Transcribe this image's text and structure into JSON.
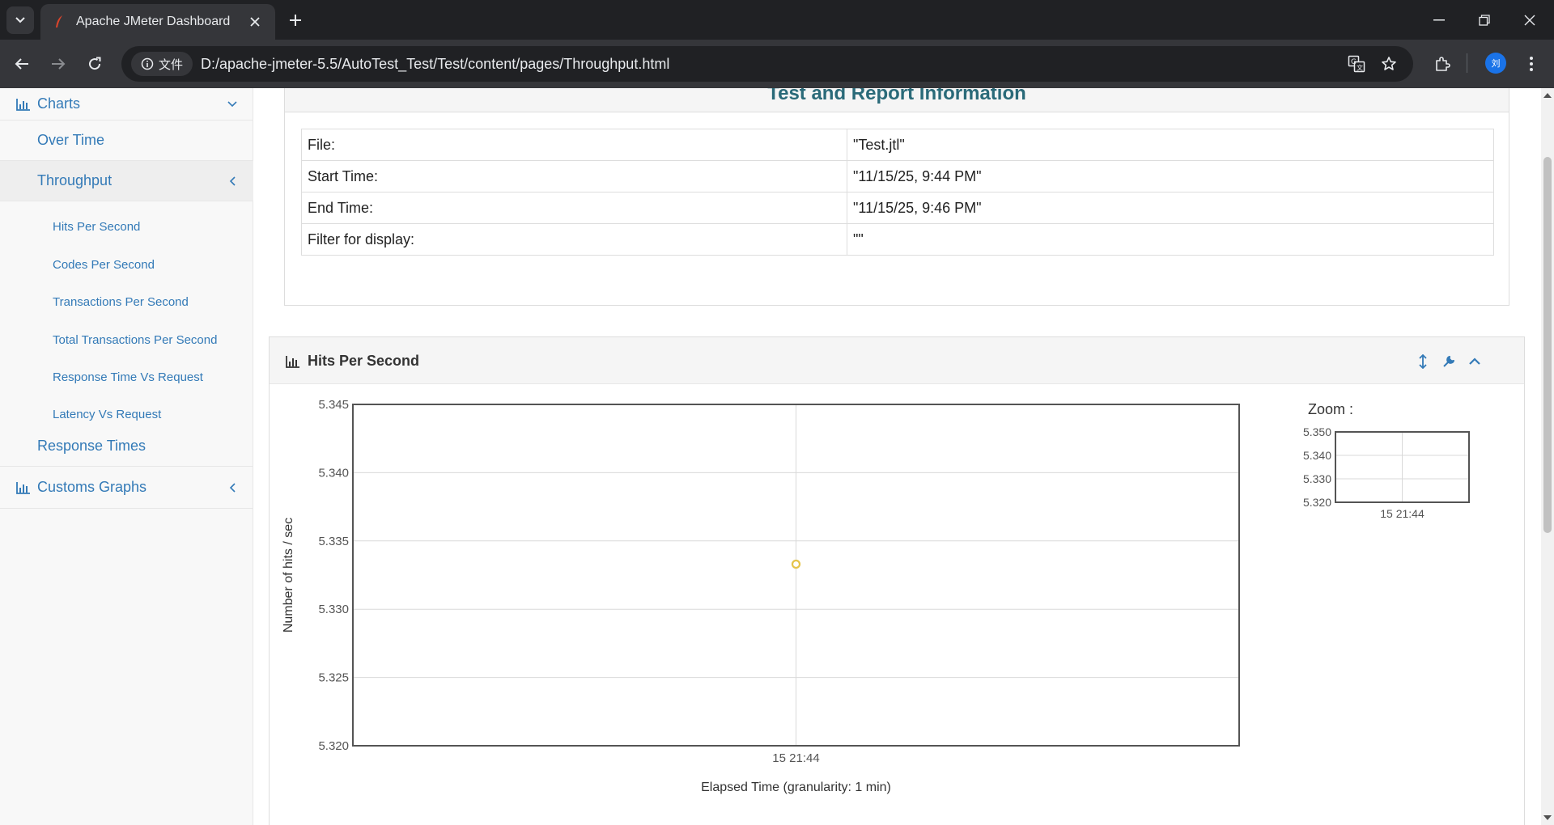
{
  "browser": {
    "tab_title": "Apache JMeter Dashboard",
    "site_chip": "文件",
    "url": "D:/apache-jmeter-5.5/AutoTest_Test/Test/content/pages/Throughput.html",
    "profile_initial": "刘"
  },
  "sidebar": {
    "charts_label": "Charts",
    "over_time": "Over Time",
    "throughput": "Throughput",
    "sub_items": [
      "Hits Per Second",
      "Codes Per Second",
      "Transactions Per Second",
      "Total Transactions Per Second",
      "Response Time Vs Request",
      "Latency Vs Request"
    ],
    "response_times": "Response Times",
    "customs_graphs": "Customs Graphs"
  },
  "info": {
    "heading": "Test and Report Information",
    "rows": [
      {
        "key": "File:",
        "value": "\"Test.jtl\""
      },
      {
        "key": "Start Time:",
        "value": "\"11/15/25, 9:44 PM\""
      },
      {
        "key": "End Time:",
        "value": "\"11/15/25, 9:46 PM\""
      },
      {
        "key": "Filter for display:",
        "value": "\"\""
      }
    ]
  },
  "chart_panel": {
    "title": "Hits Per Second",
    "zoom_label": "Zoom :"
  },
  "chart_data": [
    {
      "type": "scatter",
      "xlabel": "Elapsed Time (granularity: 1 min)",
      "ylabel": "Number of hits / sec",
      "x_ticks": [
        "15 21:44"
      ],
      "y_ticks": [
        "5.320",
        "5.325",
        "5.330",
        "5.335",
        "5.340",
        "5.345"
      ],
      "ylim": [
        5.32,
        5.345
      ],
      "points": [
        {
          "x": "15 21:44",
          "y": 5.3333
        }
      ],
      "grid": true,
      "point_color": "#e5c44a"
    },
    {
      "type": "line",
      "x_ticks": [
        "15 21:44"
      ],
      "y_ticks": [
        "5.320",
        "5.330",
        "5.340",
        "5.350"
      ],
      "ylim": [
        5.32,
        5.35
      ],
      "grid": true
    }
  ]
}
